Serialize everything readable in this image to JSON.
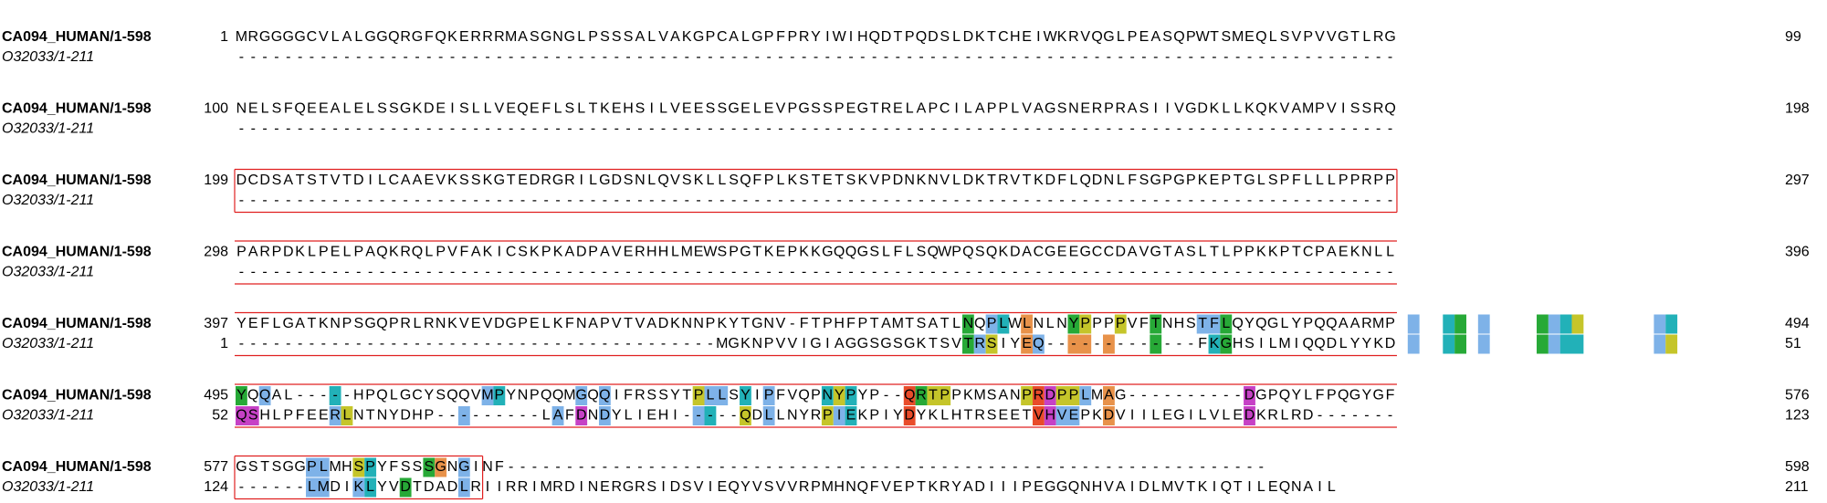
{
  "alignment": {
    "block_width": 99,
    "sequences": [
      {
        "name": "CA094_HUMAN/1-598",
        "residues": "MRGGGGCVLALGGQRGFQKERRRMASGNGLPSSSALVAKGPCALGPFPRYIWIHQDTPQDSLDKTCHEIWKRVQGLPEASQPWTSMEQLSVPVVGTLRGNELSFQEEALELSSGKDEISLLVEQEFLSLTKEHSILVEESSGELEVPGSSPEGTRELAPCILAPPLVAGSNERPRASIIVGDKLLKQKVAMPVISSRQDCDSATSTVTDILCAAEVKSSKGTEDRGRILGDSNLQVSKLLSQFPLKSTETSKVPDNKNVLDKTRVTKDFLQDNLFSGPGPKEPTGLSPFLLLPPRPPPARPDKLPELPAQKRQLPVFAKICSKPKADPAVERHHLMEWSPGTKEPKKGQQGSLFLSQWPQSQKDACGEEGCCDAVGTASLTLPPKKPTCPAEKNLLYEFLGATKNPSGQPRLRNKVEVDGPELKFNAPVTVADKNNPKYTGNV-FTPHFPTAMTSATLNQPLWLNLNYPPPPVFTNHSTFLQYQGLYPQQAARMPYQQAL-----HPQLGCYSQQVMPYNPQQMGQQIFRSSYTPLLSYIPFVQPNYPYP--QRTPPKMSANPRDPPLMAG----------DGPQYLFPQGYGFGSTSGGPLMHSPYFSSSGNGINF-----------------------------------------------------------------",
        "start_numbers": [
          "1",
          "100",
          "199",
          "298",
          "397",
          "495",
          "577"
        ],
        "end_numbers": [
          "99",
          "198",
          "297",
          "396",
          "494",
          "576",
          "598"
        ]
      },
      {
        "name": "O32033/1-211",
        "residues": "-----------------------------------------------------------------------------------------------------------------------------------------------------------------------------------------------------------------------------------------------------------------------------------------------------------------------------------------------------------------------------------------------------------------------------------------------------MGKNPVVIGIAGGSGSGKTSVTRSIYEQ-------------FKGHSILMIQQDLYYKDQSHLPFEERLNTNYDHP---------LAFDNDYLIEHI-----QDLLNYRPIEKPIYDYKLHTRSEETVHVEPKDVIILEGILVLEDKRLRD-------------LMDIKLYVDTDADLRIIRRIMRDINERGRSIDSVIEQYVSVVRPMHNQFVEPTKRYADIIIPEGGQNHVAIDLMVTKIQTILEQNAIL",
        "start_numbers": [
          "",
          "",
          "",
          "",
          "1",
          "52",
          "124"
        ],
        "end_numbers": [
          "",
          "",
          "",
          "",
          "51",
          "123",
          "211"
        ]
      }
    ],
    "highlights": [
      {
        "seq": 0,
        "row": 4,
        "start": 63,
        "end": 63,
        "color": "#27a937"
      },
      {
        "seq": 0,
        "row": 4,
        "start": 65,
        "end": 65,
        "color": "#7eb2e8"
      },
      {
        "seq": 0,
        "row": 4,
        "start": 66,
        "end": 66,
        "color": "#22b1b8"
      },
      {
        "seq": 0,
        "row": 4,
        "start": 68,
        "end": 68,
        "color": "#e8924a"
      },
      {
        "seq": 0,
        "row": 4,
        "start": 72,
        "end": 72,
        "color": "#27a937"
      },
      {
        "seq": 0,
        "row": 4,
        "start": 73,
        "end": 73,
        "color": "#c5c52a"
      },
      {
        "seq": 0,
        "row": 4,
        "start": 76,
        "end": 76,
        "color": "#c5c52a"
      },
      {
        "seq": 0,
        "row": 4,
        "start": 79,
        "end": 79,
        "color": "#27a937"
      },
      {
        "seq": 0,
        "row": 4,
        "start": 83,
        "end": 84,
        "color": "#7eb2e8"
      },
      {
        "seq": 0,
        "row": 4,
        "start": 85,
        "end": 85,
        "color": "#27a937"
      },
      {
        "seq": 0,
        "row": 4,
        "start": 101,
        "end": 101,
        "color": "#7eb2e8"
      },
      {
        "seq": 0,
        "row": 4,
        "start": 104,
        "end": 104,
        "color": "#22b1b8"
      },
      {
        "seq": 0,
        "row": 4,
        "start": 105,
        "end": 105,
        "color": "#27a937"
      },
      {
        "seq": 0,
        "row": 4,
        "start": 107,
        "end": 107,
        "color": "#7eb2e8"
      },
      {
        "seq": 0,
        "row": 4,
        "start": 112,
        "end": 112,
        "color": "#27a937"
      },
      {
        "seq": 0,
        "row": 4,
        "start": 113,
        "end": 113,
        "color": "#7eb2e8"
      },
      {
        "seq": 0,
        "row": 4,
        "start": 114,
        "end": 114,
        "color": "#22b1b8"
      },
      {
        "seq": 0,
        "row": 4,
        "start": 115,
        "end": 115,
        "color": "#c5c52a"
      },
      {
        "seq": 0,
        "row": 4,
        "start": 122,
        "end": 122,
        "color": "#7eb2e8"
      },
      {
        "seq": 0,
        "row": 4,
        "start": 123,
        "end": 123,
        "color": "#22b1b8"
      },
      {
        "seq": 1,
        "row": 4,
        "start": 63,
        "end": 63,
        "color": "#27a937"
      },
      {
        "seq": 1,
        "row": 4,
        "start": 64,
        "end": 64,
        "color": "#7eb2e8"
      },
      {
        "seq": 1,
        "row": 4,
        "start": 65,
        "end": 65,
        "color": "#c5c52a"
      },
      {
        "seq": 1,
        "row": 4,
        "start": 68,
        "end": 68,
        "color": "#e8924a"
      },
      {
        "seq": 1,
        "row": 4,
        "start": 69,
        "end": 69,
        "color": "#7eb2e8"
      },
      {
        "seq": 1,
        "row": 4,
        "start": 72,
        "end": 73,
        "color": "#e8924a"
      },
      {
        "seq": 1,
        "row": 4,
        "start": 75,
        "end": 75,
        "color": "#e8924a"
      },
      {
        "seq": 1,
        "row": 4,
        "start": 79,
        "end": 79,
        "color": "#27a937"
      },
      {
        "seq": 1,
        "row": 4,
        "start": 84,
        "end": 84,
        "color": "#22b1b8"
      },
      {
        "seq": 1,
        "row": 4,
        "start": 85,
        "end": 85,
        "color": "#27a937"
      },
      {
        "seq": 1,
        "row": 4,
        "start": 101,
        "end": 101,
        "color": "#7eb2e8"
      },
      {
        "seq": 1,
        "row": 4,
        "start": 104,
        "end": 104,
        "color": "#22b1b8"
      },
      {
        "seq": 1,
        "row": 4,
        "start": 105,
        "end": 105,
        "color": "#27a937"
      },
      {
        "seq": 1,
        "row": 4,
        "start": 107,
        "end": 107,
        "color": "#7eb2e8"
      },
      {
        "seq": 1,
        "row": 4,
        "start": 112,
        "end": 112,
        "color": "#27a937"
      },
      {
        "seq": 1,
        "row": 4,
        "start": 113,
        "end": 113,
        "color": "#7eb2e8"
      },
      {
        "seq": 1,
        "row": 4,
        "start": 114,
        "end": 115,
        "color": "#22b1b8"
      },
      {
        "seq": 1,
        "row": 4,
        "start": 122,
        "end": 122,
        "color": "#7eb2e8"
      },
      {
        "seq": 1,
        "row": 4,
        "start": 123,
        "end": 123,
        "color": "#c5c52a"
      },
      {
        "seq": 0,
        "row": 5,
        "start": 1,
        "end": 1,
        "color": "#27a937"
      },
      {
        "seq": 0,
        "row": 5,
        "start": 3,
        "end": 3,
        "color": "#7eb2e8"
      },
      {
        "seq": 0,
        "row": 5,
        "start": 9,
        "end": 9,
        "color": "#22b1b8"
      },
      {
        "seq": 0,
        "row": 5,
        "start": 22,
        "end": 22,
        "color": "#7eb2e8"
      },
      {
        "seq": 0,
        "row": 5,
        "start": 23,
        "end": 23,
        "color": "#22b1b8"
      },
      {
        "seq": 0,
        "row": 5,
        "start": 30,
        "end": 30,
        "color": "#7eb2e8"
      },
      {
        "seq": 0,
        "row": 5,
        "start": 32,
        "end": 32,
        "color": "#7eb2e8"
      },
      {
        "seq": 0,
        "row": 5,
        "start": 40,
        "end": 40,
        "color": "#c5c52a"
      },
      {
        "seq": 0,
        "row": 5,
        "start": 41,
        "end": 42,
        "color": "#7eb2e8"
      },
      {
        "seq": 0,
        "row": 5,
        "start": 44,
        "end": 44,
        "color": "#22b1b8"
      },
      {
        "seq": 0,
        "row": 5,
        "start": 46,
        "end": 46,
        "color": "#7eb2e8"
      },
      {
        "seq": 0,
        "row": 5,
        "start": 51,
        "end": 51,
        "color": "#22b1b8"
      },
      {
        "seq": 0,
        "row": 5,
        "start": 52,
        "end": 52,
        "color": "#c5c52a"
      },
      {
        "seq": 0,
        "row": 5,
        "start": 53,
        "end": 53,
        "color": "#22b1b8"
      },
      {
        "seq": 0,
        "row": 5,
        "start": 58,
        "end": 58,
        "color": "#e94c2a"
      },
      {
        "seq": 0,
        "row": 5,
        "start": 59,
        "end": 59,
        "color": "#27a937"
      },
      {
        "seq": 0,
        "row": 5,
        "start": 60,
        "end": 61,
        "color": "#c5c52a"
      },
      {
        "seq": 0,
        "row": 5,
        "start": 68,
        "end": 68,
        "color": "#c5c52a"
      },
      {
        "seq": 0,
        "row": 5,
        "start": 69,
        "end": 69,
        "color": "#e94c2a"
      },
      {
        "seq": 0,
        "row": 5,
        "start": 70,
        "end": 70,
        "color": "#c641c6"
      },
      {
        "seq": 0,
        "row": 5,
        "start": 71,
        "end": 72,
        "color": "#c5c52a"
      },
      {
        "seq": 0,
        "row": 5,
        "start": 73,
        "end": 73,
        "color": "#7eb2e8"
      },
      {
        "seq": 0,
        "row": 5,
        "start": 75,
        "end": 75,
        "color": "#e8924a"
      },
      {
        "seq": 0,
        "row": 5,
        "start": 87,
        "end": 87,
        "color": "#c641c6"
      },
      {
        "seq": 1,
        "row": 5,
        "start": 1,
        "end": 2,
        "color": "#c641c6"
      },
      {
        "seq": 1,
        "row": 5,
        "start": 9,
        "end": 9,
        "color": "#7eb2e8"
      },
      {
        "seq": 1,
        "row": 5,
        "start": 10,
        "end": 10,
        "color": "#c5c52a"
      },
      {
        "seq": 1,
        "row": 5,
        "start": 20,
        "end": 20,
        "color": "#7eb2e8"
      },
      {
        "seq": 1,
        "row": 5,
        "start": 28,
        "end": 28,
        "color": "#7eb2e8"
      },
      {
        "seq": 1,
        "row": 5,
        "start": 30,
        "end": 30,
        "color": "#c641c6"
      },
      {
        "seq": 1,
        "row": 5,
        "start": 32,
        "end": 32,
        "color": "#7eb2e8"
      },
      {
        "seq": 1,
        "row": 5,
        "start": 40,
        "end": 40,
        "color": "#7eb2e8"
      },
      {
        "seq": 1,
        "row": 5,
        "start": 41,
        "end": 41,
        "color": "#22b1b8"
      },
      {
        "seq": 1,
        "row": 5,
        "start": 44,
        "end": 44,
        "color": "#c5c52a"
      },
      {
        "seq": 1,
        "row": 5,
        "start": 46,
        "end": 46,
        "color": "#7eb2e8"
      },
      {
        "seq": 1,
        "row": 5,
        "start": 51,
        "end": 51,
        "color": "#c5c52a"
      },
      {
        "seq": 1,
        "row": 5,
        "start": 52,
        "end": 52,
        "color": "#7eb2e8"
      },
      {
        "seq": 1,
        "row": 5,
        "start": 53,
        "end": 53,
        "color": "#22b1b8"
      },
      {
        "seq": 1,
        "row": 5,
        "start": 58,
        "end": 58,
        "color": "#e94c2a"
      },
      {
        "seq": 1,
        "row": 5,
        "start": 69,
        "end": 69,
        "color": "#e94c2a"
      },
      {
        "seq": 1,
        "row": 5,
        "start": 70,
        "end": 70,
        "color": "#c641c6"
      },
      {
        "seq": 1,
        "row": 5,
        "start": 71,
        "end": 72,
        "color": "#7eb2e8"
      },
      {
        "seq": 1,
        "row": 5,
        "start": 75,
        "end": 75,
        "color": "#e8924a"
      },
      {
        "seq": 1,
        "row": 5,
        "start": 87,
        "end": 87,
        "color": "#c641c6"
      },
      {
        "seq": 0,
        "row": 6,
        "start": 7,
        "end": 8,
        "color": "#7eb2e8"
      },
      {
        "seq": 0,
        "row": 6,
        "start": 11,
        "end": 11,
        "color": "#c5c52a"
      },
      {
        "seq": 0,
        "row": 6,
        "start": 12,
        "end": 12,
        "color": "#22b1b8"
      },
      {
        "seq": 0,
        "row": 6,
        "start": 17,
        "end": 17,
        "color": "#27a937"
      },
      {
        "seq": 0,
        "row": 6,
        "start": 18,
        "end": 18,
        "color": "#e8924a"
      },
      {
        "seq": 0,
        "row": 6,
        "start": 20,
        "end": 20,
        "color": "#7eb2e8"
      },
      {
        "seq": 1,
        "row": 6,
        "start": 7,
        "end": 8,
        "color": "#7eb2e8"
      },
      {
        "seq": 1,
        "row": 6,
        "start": 11,
        "end": 11,
        "color": "#7eb2e8"
      },
      {
        "seq": 1,
        "row": 6,
        "start": 12,
        "end": 12,
        "color": "#22b1b8"
      },
      {
        "seq": 1,
        "row": 6,
        "start": 15,
        "end": 15,
        "color": "#27a937"
      },
      {
        "seq": 1,
        "row": 6,
        "start": 20,
        "end": 20,
        "color": "#7eb2e8"
      }
    ],
    "frames": [
      {
        "row": 2,
        "start": 1,
        "end": 99,
        "color": "#e02020",
        "closed_left": true,
        "closed_right": true
      },
      {
        "row": 3,
        "start": 1,
        "end": 99,
        "color": "#e02020",
        "closed_left": false,
        "closed_right": false
      },
      {
        "row": 4,
        "start": 1,
        "end": 99,
        "color": "#e02020",
        "closed_left": false,
        "closed_right": false
      },
      {
        "row": 5,
        "start": 1,
        "end": 99,
        "color": "#e02020",
        "closed_left": false,
        "closed_right": false
      },
      {
        "row": 6,
        "start": 1,
        "end": 21,
        "color": "#e02020",
        "closed_left": true,
        "closed_right": true
      }
    ]
  }
}
